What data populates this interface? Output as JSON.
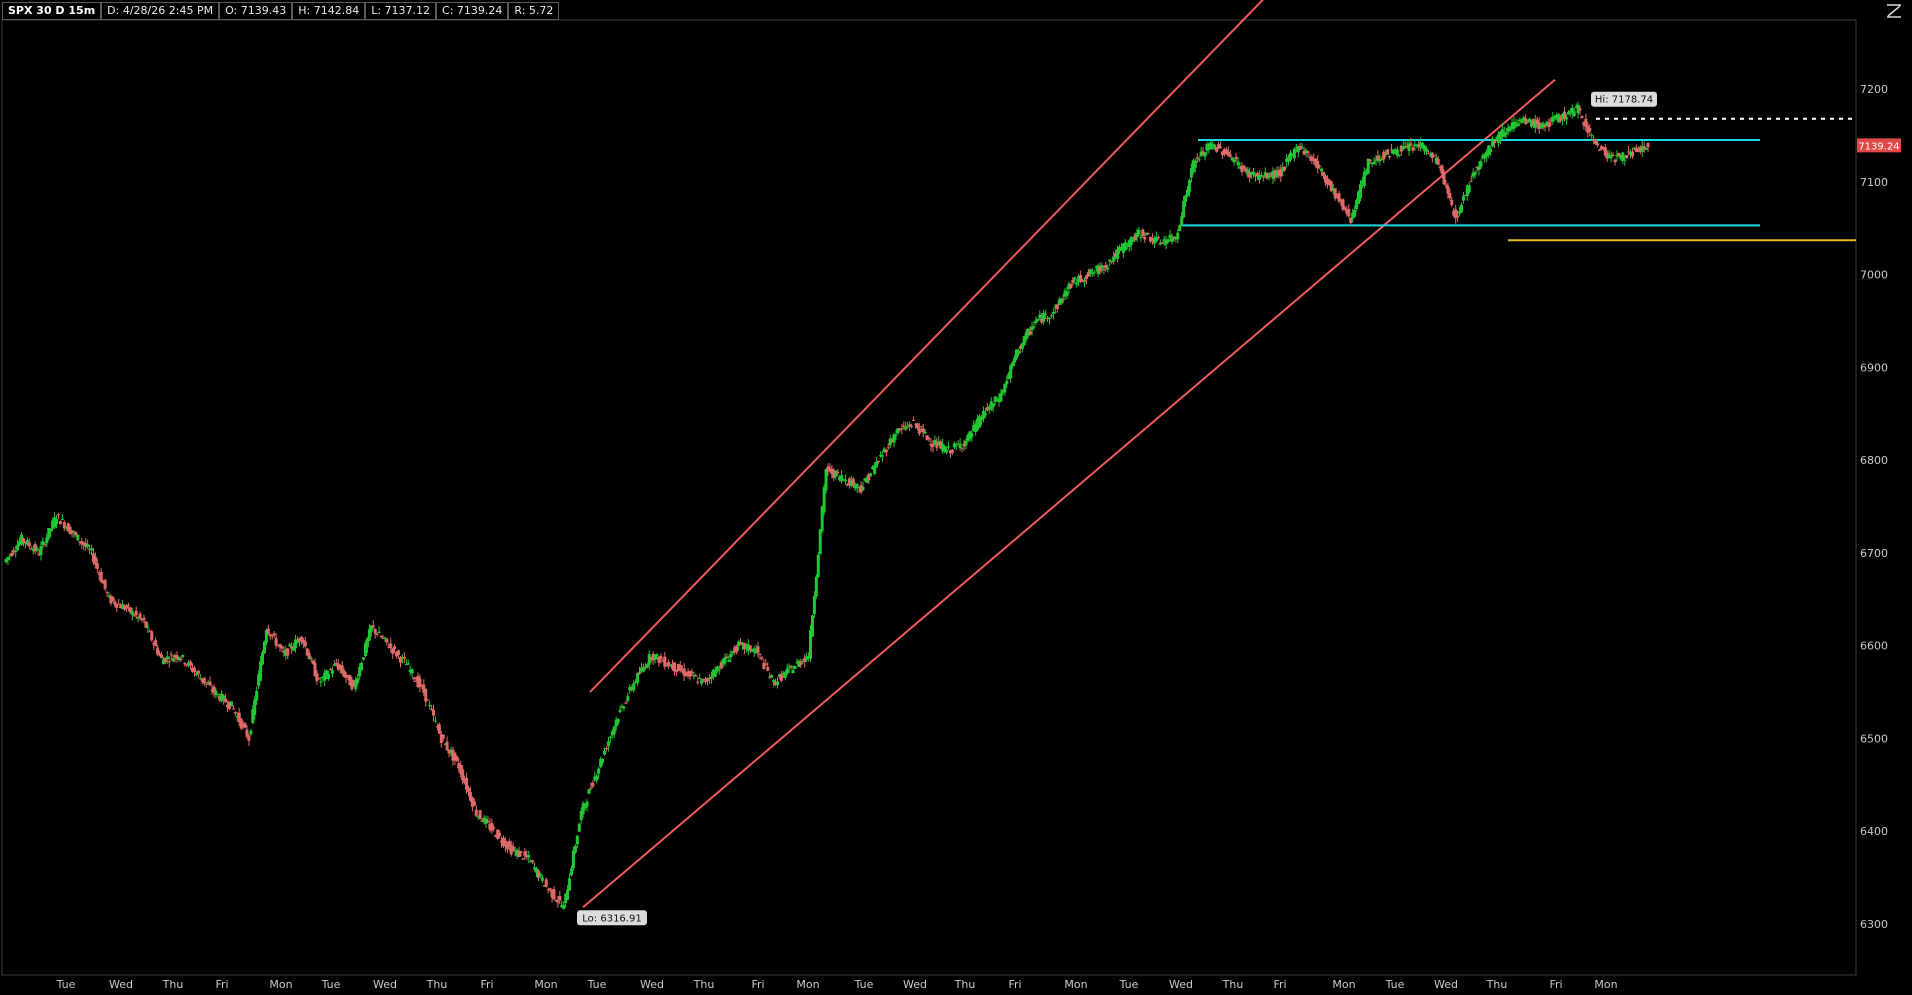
{
  "header": {
    "symbol": "SPX 30 D 15m",
    "date": "D: 4/28/26 2:45 PM",
    "open": "O: 7139.43",
    "high": "H: 7142.84",
    "low": "L: 7137.12",
    "close": "C: 7139.24",
    "range": "R: 5.72"
  },
  "colors": {
    "background": "#000000",
    "up_candle": "#22c733",
    "down_candle": "#e06a6a",
    "channel": "#f05a5a",
    "range_lines": "#20d8e0",
    "support": "#e8b820",
    "last_price_tag": "#e04848",
    "axis_text": "#c8c8c8"
  },
  "icons": {
    "corner": "chart-style-icon"
  },
  "chart_data": {
    "type": "candlestick",
    "ylim": [
      6260,
      7240
    ],
    "y_ticks": [
      6300,
      6400,
      6500,
      6600,
      6700,
      6800,
      6900,
      7000,
      7100,
      7200
    ],
    "x_tick_labels": [
      "Tue",
      "Wed",
      "Thu",
      "Fri",
      "Mon",
      "Tue",
      "Wed",
      "Thu",
      "Fri",
      "Mon",
      "Tue",
      "Wed",
      "Thu",
      "Fri",
      "Mon",
      "Tue",
      "Wed",
      "Thu",
      "Fri",
      "Mon",
      "Tue",
      "Wed",
      "Thu",
      "Fri",
      "Mon",
      "Tue",
      "Wed",
      "Thu",
      "Fri",
      "Mon"
    ],
    "last_price": 7139.24,
    "last_price_label": "7139.24",
    "high_label": "Hi: 7178.74",
    "low_label": "Lo: 6316.91",
    "high_value": 7178.74,
    "low_value": 6316.91,
    "price_path": [
      [
        0,
        6690
      ],
      [
        1,
        6715
      ],
      [
        2,
        6700
      ],
      [
        3,
        6740
      ],
      [
        4,
        6720
      ],
      [
        5,
        6700
      ],
      [
        6,
        6650
      ],
      [
        7,
        6640
      ],
      [
        8,
        6625
      ],
      [
        9,
        6585
      ],
      [
        10,
        6590
      ],
      [
        11,
        6570
      ],
      [
        12,
        6550
      ],
      [
        13,
        6535
      ],
      [
        14,
        6500
      ],
      [
        15,
        6620
      ],
      [
        16,
        6590
      ],
      [
        17,
        6610
      ],
      [
        18,
        6560
      ],
      [
        19,
        6580
      ],
      [
        20,
        6555
      ],
      [
        21,
        6620
      ],
      [
        22,
        6600
      ],
      [
        23,
        6580
      ],
      [
        24,
        6550
      ],
      [
        25,
        6500
      ],
      [
        26,
        6470
      ],
      [
        27,
        6420
      ],
      [
        28,
        6400
      ],
      [
        29,
        6380
      ],
      [
        30,
        6370
      ],
      [
        31,
        6340
      ],
      [
        32,
        6318
      ],
      [
        33,
        6420
      ],
      [
        34,
        6470
      ],
      [
        35,
        6520
      ],
      [
        36,
        6560
      ],
      [
        37,
        6590
      ],
      [
        38,
        6580
      ],
      [
        39,
        6570
      ],
      [
        40,
        6560
      ],
      [
        41,
        6580
      ],
      [
        42,
        6600
      ],
      [
        43,
        6595
      ],
      [
        44,
        6560
      ],
      [
        45,
        6575
      ],
      [
        46,
        6590
      ],
      [
        47,
        6790
      ],
      [
        48,
        6780
      ],
      [
        49,
        6770
      ],
      [
        50,
        6800
      ],
      [
        51,
        6830
      ],
      [
        52,
        6840
      ],
      [
        53,
        6820
      ],
      [
        54,
        6810
      ],
      [
        55,
        6820
      ],
      [
        56,
        6850
      ],
      [
        57,
        6870
      ],
      [
        58,
        6920
      ],
      [
        59,
        6950
      ],
      [
        60,
        6960
      ],
      [
        61,
        6990
      ],
      [
        62,
        7000
      ],
      [
        63,
        7010
      ],
      [
        64,
        7030
      ],
      [
        65,
        7045
      ],
      [
        66,
        7035
      ],
      [
        67,
        7040
      ],
      [
        68,
        7120
      ],
      [
        69,
        7140
      ],
      [
        70,
        7130
      ],
      [
        71,
        7110
      ],
      [
        72,
        7105
      ],
      [
        73,
        7110
      ],
      [
        74,
        7140
      ],
      [
        75,
        7120
      ],
      [
        76,
        7090
      ],
      [
        77,
        7060
      ],
      [
        78,
        7120
      ],
      [
        79,
        7130
      ],
      [
        80,
        7135
      ],
      [
        81,
        7140
      ],
      [
        82,
        7120
      ],
      [
        83,
        7060
      ],
      [
        84,
        7110
      ],
      [
        85,
        7140
      ],
      [
        86,
        7160
      ],
      [
        87,
        7165
      ],
      [
        88,
        7160
      ],
      [
        89,
        7170
      ],
      [
        90,
        7178
      ],
      [
        91,
        7140
      ],
      [
        92,
        7125
      ],
      [
        93,
        7130
      ],
      [
        94,
        7139
      ]
    ],
    "drawings": {
      "channel_upper": [
        [
          32,
          6550
        ],
        [
          75,
          7340
        ]
      ],
      "channel_lower": [
        [
          32,
          6318
        ],
        [
          85,
          7210
        ]
      ],
      "range_top": 7145,
      "range_bottom": 7053,
      "support": 7037,
      "high_dotted": 7168
    }
  }
}
